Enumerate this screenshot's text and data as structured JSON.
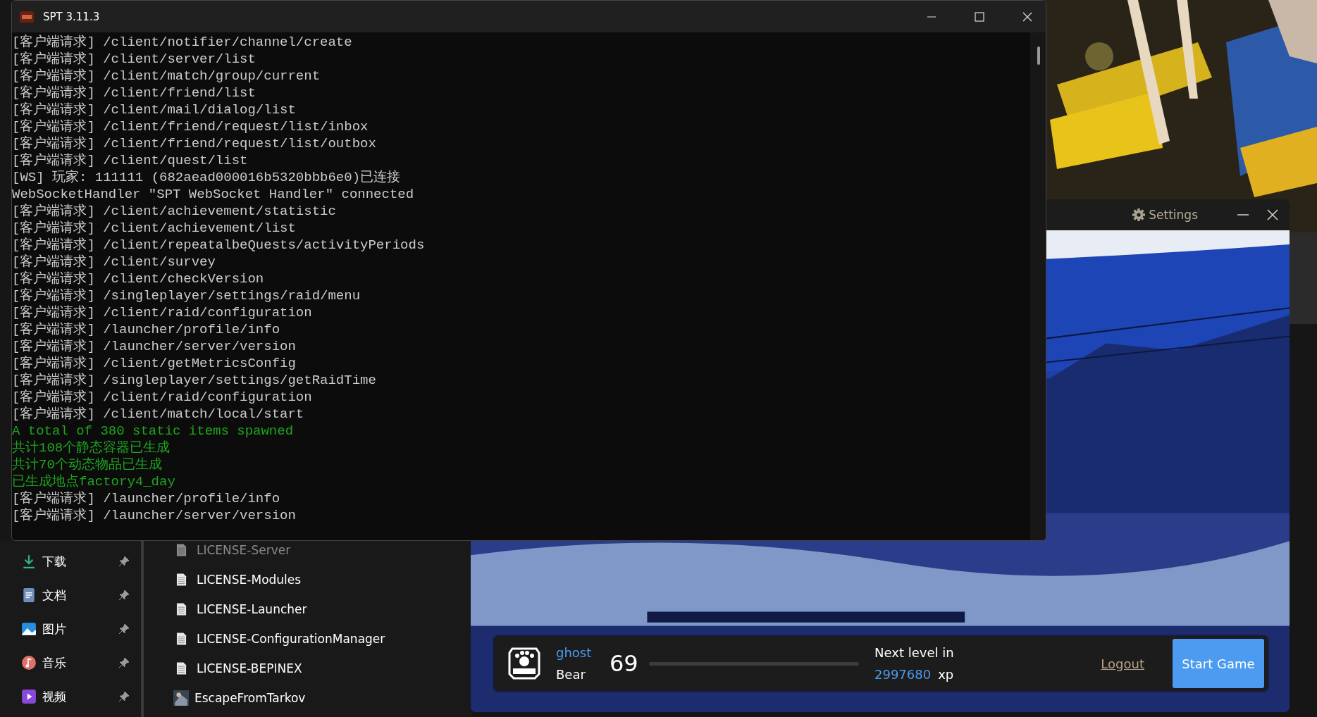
{
  "explorer": {
    "sidebar": [
      {
        "label": "下载"
      },
      {
        "label": "文档"
      },
      {
        "label": "图片"
      },
      {
        "label": "音乐"
      },
      {
        "label": "视频"
      }
    ],
    "files": [
      {
        "name": "LICENSE-Server",
        "kind": "text",
        "dimmed": true
      },
      {
        "name": "LICENSE-Modules",
        "kind": "text",
        "dimmed": false
      },
      {
        "name": "LICENSE-Launcher",
        "kind": "text",
        "dimmed": false
      },
      {
        "name": "LICENSE-ConfigurationManager",
        "kind": "text",
        "dimmed": false
      },
      {
        "name": "LICENSE-BEPINEX",
        "kind": "text",
        "dimmed": false
      },
      {
        "name": "EscapeFromTarkov",
        "kind": "app",
        "dimmed": false
      }
    ]
  },
  "launcher": {
    "settings": "Settings",
    "profile": {
      "username": "ghost",
      "side": "Bear",
      "level_number": "69",
      "next_level_label": "Next level in",
      "xp_needed": "2997680",
      "xp_unit": "xp"
    },
    "logout": "Logout",
    "start": "Start Game"
  },
  "console": {
    "title": "SPT 3.11.3",
    "lines": [
      {
        "text": "[客户端请求] /client/notifier/channel/create",
        "kind": "normal"
      },
      {
        "text": "[客户端请求] /client/server/list",
        "kind": "normal"
      },
      {
        "text": "[客户端请求] /client/match/group/current",
        "kind": "normal"
      },
      {
        "text": "[客户端请求] /client/friend/list",
        "kind": "normal"
      },
      {
        "text": "[客户端请求] /client/mail/dialog/list",
        "kind": "normal"
      },
      {
        "text": "[客户端请求] /client/friend/request/list/inbox",
        "kind": "normal"
      },
      {
        "text": "[客户端请求] /client/friend/request/list/outbox",
        "kind": "normal"
      },
      {
        "text": "[客户端请求] /client/quest/list",
        "kind": "normal"
      },
      {
        "text": "[WS] 玩家: 111111 (682aead000016b5320bbb6e0)已连接",
        "kind": "normal"
      },
      {
        "text": "WebSocketHandler \"SPT WebSocket Handler\" connected",
        "kind": "normal"
      },
      {
        "text": "[客户端请求] /client/achievement/statistic",
        "kind": "normal"
      },
      {
        "text": "[客户端请求] /client/achievement/list",
        "kind": "normal"
      },
      {
        "text": "[客户端请求] /client/repeatalbeQuests/activityPeriods",
        "kind": "normal"
      },
      {
        "text": "[客户端请求] /client/survey",
        "kind": "normal"
      },
      {
        "text": "[客户端请求] /client/checkVersion",
        "kind": "normal"
      },
      {
        "text": "[客户端请求] /singleplayer/settings/raid/menu",
        "kind": "normal"
      },
      {
        "text": "[客户端请求] /client/raid/configuration",
        "kind": "normal"
      },
      {
        "text": "[客户端请求] /launcher/profile/info",
        "kind": "normal"
      },
      {
        "text": "[客户端请求] /launcher/server/version",
        "kind": "normal"
      },
      {
        "text": "[客户端请求] /client/getMetricsConfig",
        "kind": "normal"
      },
      {
        "text": "[客户端请求] /singleplayer/settings/getRaidTime",
        "kind": "normal"
      },
      {
        "text": "[客户端请求] /client/raid/configuration",
        "kind": "normal"
      },
      {
        "text": "[客户端请求] /client/match/local/start",
        "kind": "normal"
      },
      {
        "text": "A total of 380 static items spawned",
        "kind": "success"
      },
      {
        "text": "共计108个静态容器已生成",
        "kind": "success"
      },
      {
        "text": "共计70个动态物品已生成",
        "kind": "success"
      },
      {
        "text": "已生成地点factory4_day",
        "kind": "success"
      },
      {
        "text": "[客户端请求] /launcher/profile/info",
        "kind": "normal"
      },
      {
        "text": "[客户端请求] /launcher/server/version",
        "kind": "normal"
      }
    ]
  }
}
